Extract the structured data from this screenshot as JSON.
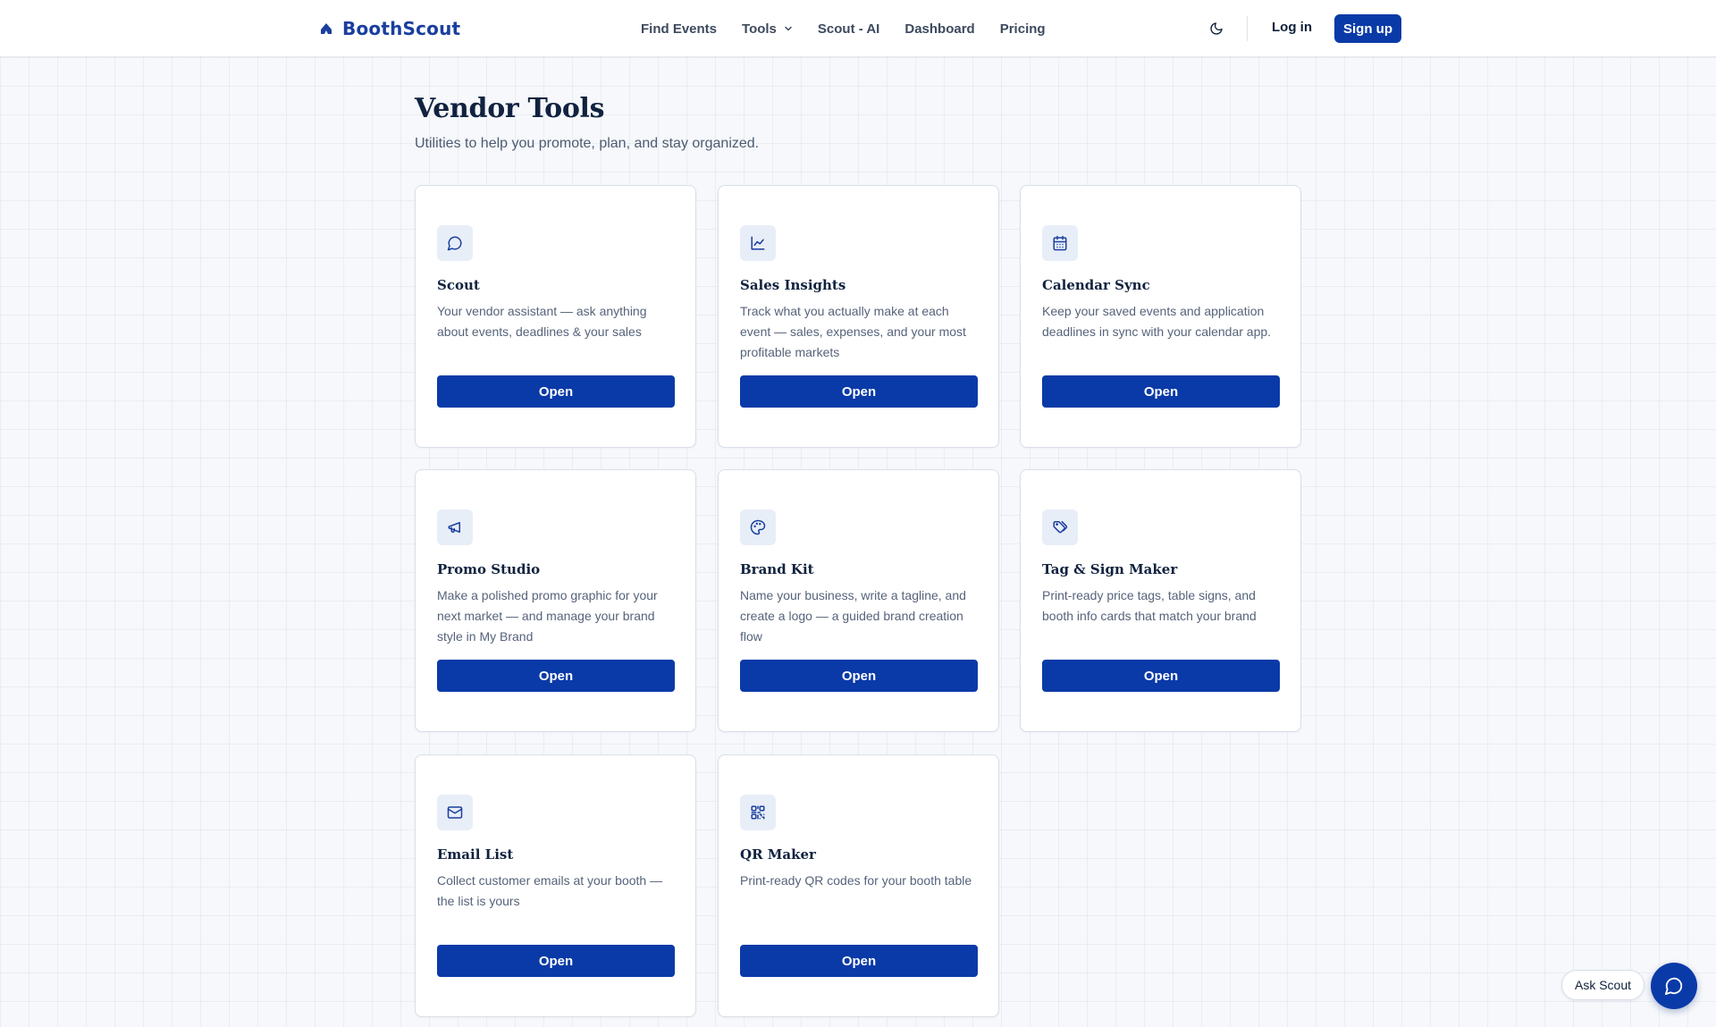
{
  "header": {
    "brand": "BoothScout",
    "nav": [
      {
        "label": "Find Events"
      },
      {
        "label": "Tools"
      },
      {
        "label": "Scout - AI"
      },
      {
        "label": "Dashboard"
      },
      {
        "label": "Pricing"
      }
    ],
    "theme_icon": "moon-icon",
    "login_label": "Log in",
    "signup_label": "Sign up"
  },
  "page": {
    "title": "Vendor Tools",
    "subtitle": "Utilities to help you promote, plan, and stay organized."
  },
  "tools": [
    {
      "icon": "message-circle-icon",
      "title": "Scout",
      "description": "Your vendor assistant — ask anything about events, deadlines & your sales",
      "button": "Open"
    },
    {
      "icon": "line-chart-icon",
      "title": "Sales Insights",
      "description": "Track what you actually make at each event — sales, expenses, and your most profitable markets",
      "button": "Open"
    },
    {
      "icon": "calendar-icon",
      "title": "Calendar Sync",
      "description": "Keep your saved events and application deadlines in sync with your calendar app.",
      "button": "Open"
    },
    {
      "icon": "megaphone-icon",
      "title": "Promo Studio",
      "description": "Make a polished promo graphic for your next market — and manage your brand style in My Brand",
      "button": "Open"
    },
    {
      "icon": "palette-icon",
      "title": "Brand Kit",
      "description": "Name your business, write a tagline, and create a logo — a guided brand creation flow",
      "button": "Open"
    },
    {
      "icon": "tags-icon",
      "title": "Tag & Sign Maker",
      "description": "Print-ready price tags, table signs, and booth info cards that match your brand",
      "button": "Open"
    },
    {
      "icon": "mail-icon",
      "title": "Email List",
      "description": "Collect customer emails at your booth — the list is yours",
      "button": "Open"
    },
    {
      "icon": "qr-code-icon",
      "title": "QR Maker",
      "description": "Print-ready QR codes for your booth table",
      "button": "Open"
    }
  ],
  "floating": {
    "ask_label": "Ask Scout",
    "chat_icon": "message-circle-icon"
  },
  "colors": {
    "brand": "#1a3f9e",
    "primary_button": "#0a3aa8",
    "icon_tile": "#e8eef8"
  }
}
